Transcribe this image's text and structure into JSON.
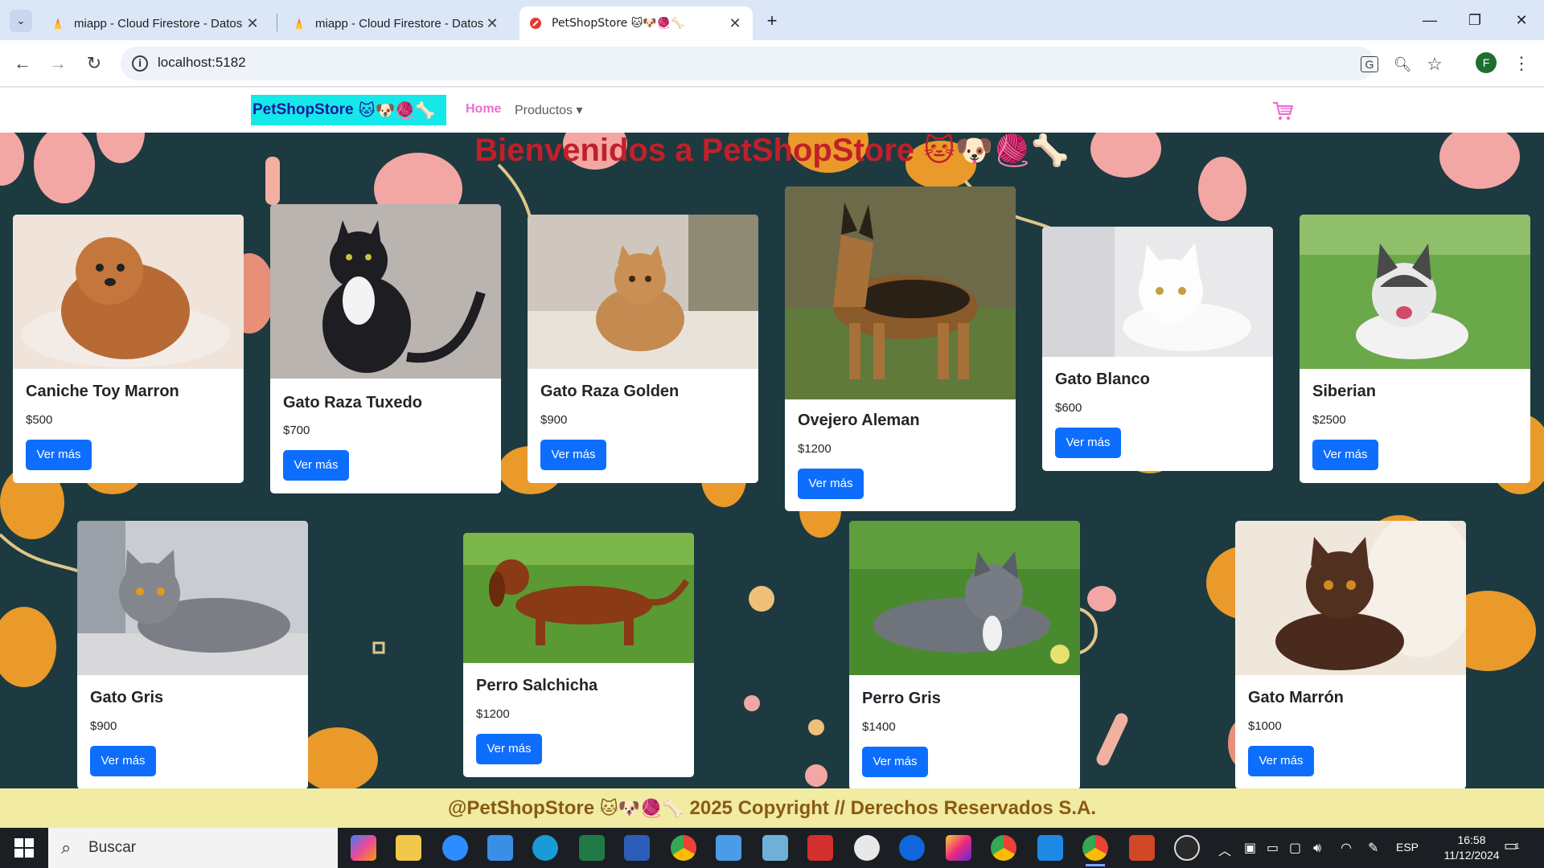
{
  "browser": {
    "tabs": [
      {
        "title": "miapp - Cloud Firestore - Datos",
        "icon": "firebase-icon"
      },
      {
        "title": "miapp - Cloud Firestore - Datos",
        "icon": "firebase-icon"
      },
      {
        "title": "PetShopStore 🐱🐶🧶🦴",
        "icon": "react-icon",
        "active": true
      }
    ],
    "url": "localhost:5182"
  },
  "navbar": {
    "brand": "PetShopStore",
    "brand_emoji": "🐱🐶🧶🦴",
    "home": "Home",
    "products": "Productos ▾"
  },
  "hero": {
    "title": "Bienvenidos a PetShopStore",
    "title_emoji": "🐱🐶🧶🦴"
  },
  "products": [
    {
      "name": "Caniche Toy Marron",
      "price": "$500",
      "button": "Ver más",
      "image": "brown-toy-poodle-photo"
    },
    {
      "name": "Gato Raza Tuxedo",
      "price": "$700",
      "button": "Ver más",
      "image": "tuxedo-cat-photo"
    },
    {
      "name": "Gato Raza Golden",
      "price": "$900",
      "button": "Ver más",
      "image": "golden-cat-photo"
    },
    {
      "name": "Ovejero Aleman",
      "price": "$1200",
      "button": "Ver más",
      "image": "german-shepherd-photo"
    },
    {
      "name": "Gato Blanco",
      "price": "$600",
      "button": "Ver más",
      "image": "white-cat-photo"
    },
    {
      "name": "Siberian",
      "price": "$2500",
      "button": "Ver más",
      "image": "siberian-husky-photo"
    },
    {
      "name": "Gato Gris",
      "price": "$900",
      "button": "Ver más",
      "image": "gray-cat-photo"
    },
    {
      "name": "Perro Salchicha",
      "price": "$1200",
      "button": "Ver más",
      "image": "dachshund-photo"
    },
    {
      "name": "Perro Gris",
      "price": "$1400",
      "button": "Ver más",
      "image": "gray-pitbull-photo"
    },
    {
      "name": "Gato Marrón",
      "price": "$1000",
      "button": "Ver más",
      "image": "brown-cat-photo"
    }
  ],
  "footer": {
    "text_start": "@PetShopStore",
    "emoji": "🐱🐶🧶🦴",
    "text_end": "2025 Copyright // Derechos Reservados S.A."
  },
  "taskbar": {
    "search_placeholder": "Buscar",
    "language": "ESP",
    "time": "16:58",
    "date": "11/12/2024",
    "notifications": "1"
  },
  "colors": {
    "hero_bg": "#1c3a40",
    "paw_orange": "#e99a2a",
    "paw_pink": "#f2a7a4",
    "button_blue": "#0d6efd",
    "title_red": "#c0202a",
    "footer_bg": "#f1eba4"
  }
}
